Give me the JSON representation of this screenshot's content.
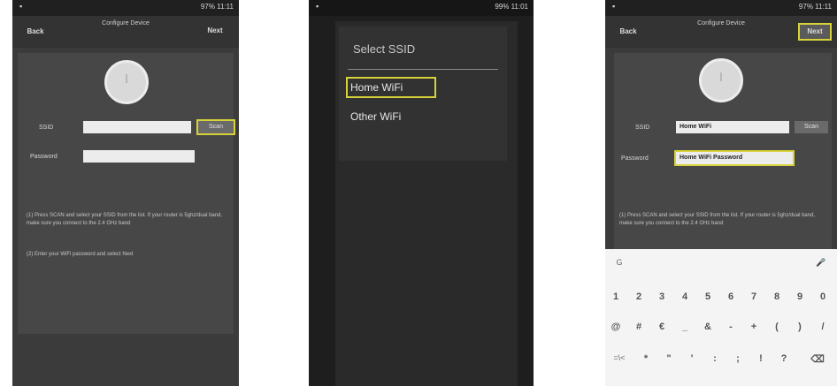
{
  "status_bar": {
    "left_icon": "notification-icon",
    "right_text": "97% 11:11",
    "screen2_right_text": "99% 11:01"
  },
  "appbar": {
    "back_label": "Back",
    "title": "Configure Device",
    "next_label": "Next"
  },
  "form": {
    "ssid_label": "SSID",
    "password_label": "Password",
    "scan_label": "Scan",
    "ssid_value_empty": "",
    "password_value_empty": "",
    "ssid_value": "Home WiFi",
    "password_value": "Home WiFi Password"
  },
  "instructions": {
    "step1": "(1) Press SCAN and select your SSID from the list. If your router is 5ghz/dual band, make sure you connect to the 2.4 GHz band",
    "step2": "(2) Enter your WiFi password and select Next"
  },
  "dialog": {
    "title": "Select SSID",
    "options": [
      "Home WiFi",
      "Other WiFi"
    ]
  },
  "keyboard": {
    "row0": [
      "G",
      "🎤"
    ],
    "row1": [
      "1",
      "2",
      "3",
      "4",
      "5",
      "6",
      "7",
      "8",
      "9",
      "0"
    ],
    "row2": [
      "@",
      "#",
      "€",
      "_",
      "&",
      "-",
      "+",
      "(",
      ")",
      "/"
    ],
    "row3": [
      "=\\<",
      "*",
      "\"",
      "'",
      ":",
      ";",
      "!",
      "?",
      "⌫"
    ]
  },
  "colors": {
    "highlight": "#d7d23a",
    "screen_bg": "#3b3b3b",
    "card_bg": "#474747"
  }
}
